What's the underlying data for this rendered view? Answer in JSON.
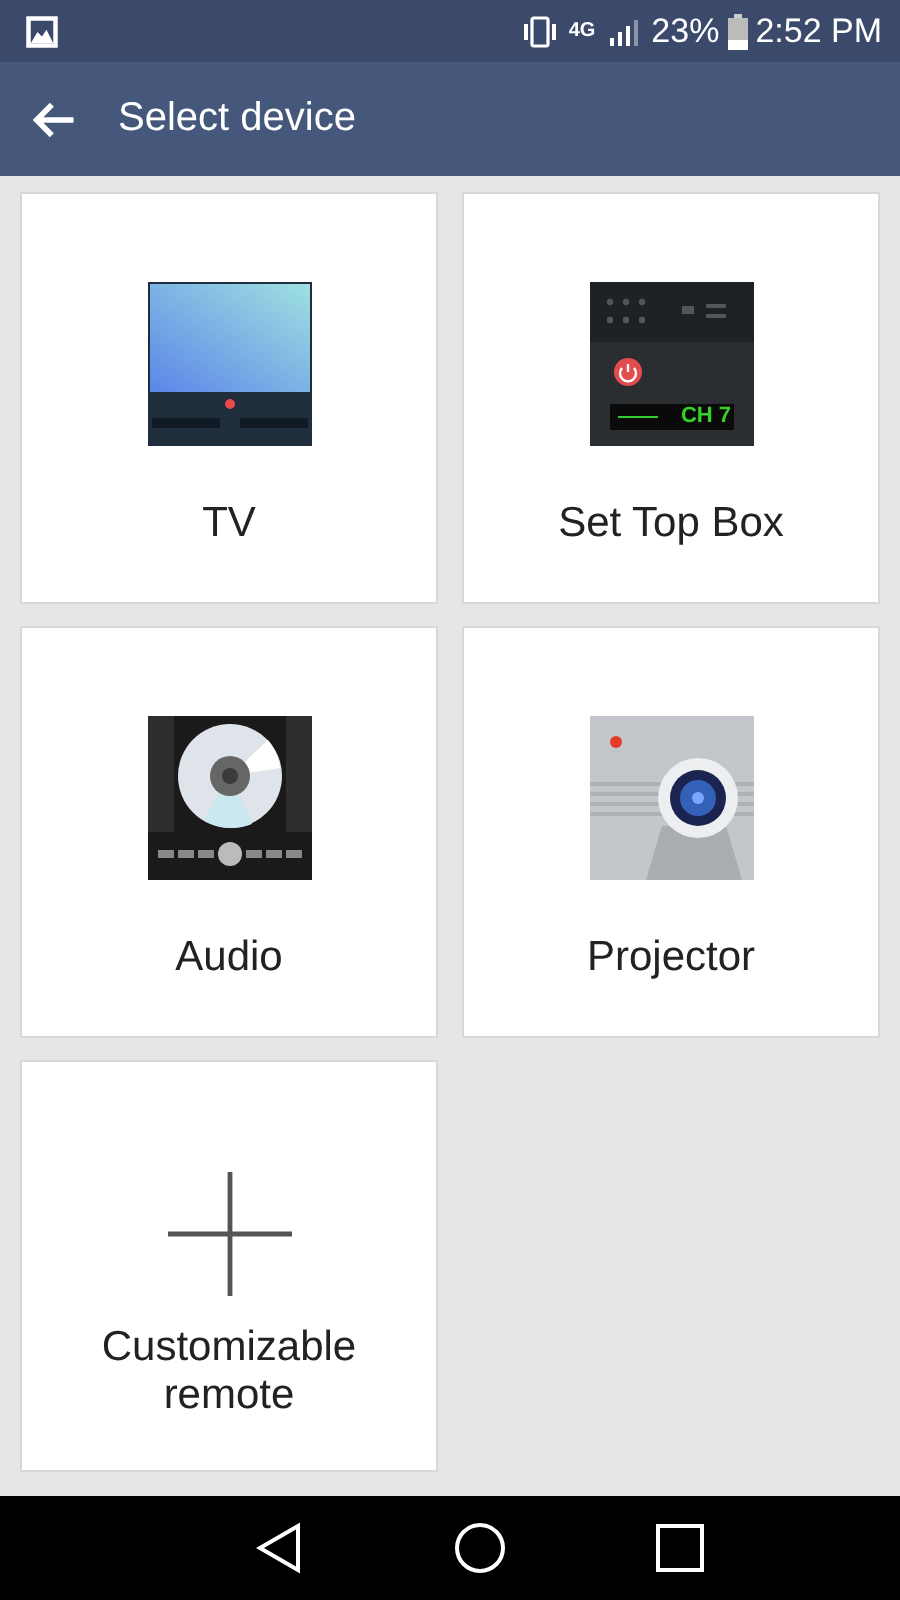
{
  "status_bar": {
    "network": "4G",
    "battery": "23%",
    "time": "2:52 PM"
  },
  "app_bar": {
    "title": "Select device"
  },
  "devices": [
    {
      "kind": "tv",
      "label": "TV"
    },
    {
      "kind": "settop",
      "label": "Set Top Box"
    },
    {
      "kind": "audio",
      "label": "Audio"
    },
    {
      "kind": "projector",
      "label": "Projector"
    },
    {
      "kind": "custom",
      "label": "Customizable remote"
    }
  ],
  "set_top_box_icon": {
    "display": "CH 7"
  }
}
